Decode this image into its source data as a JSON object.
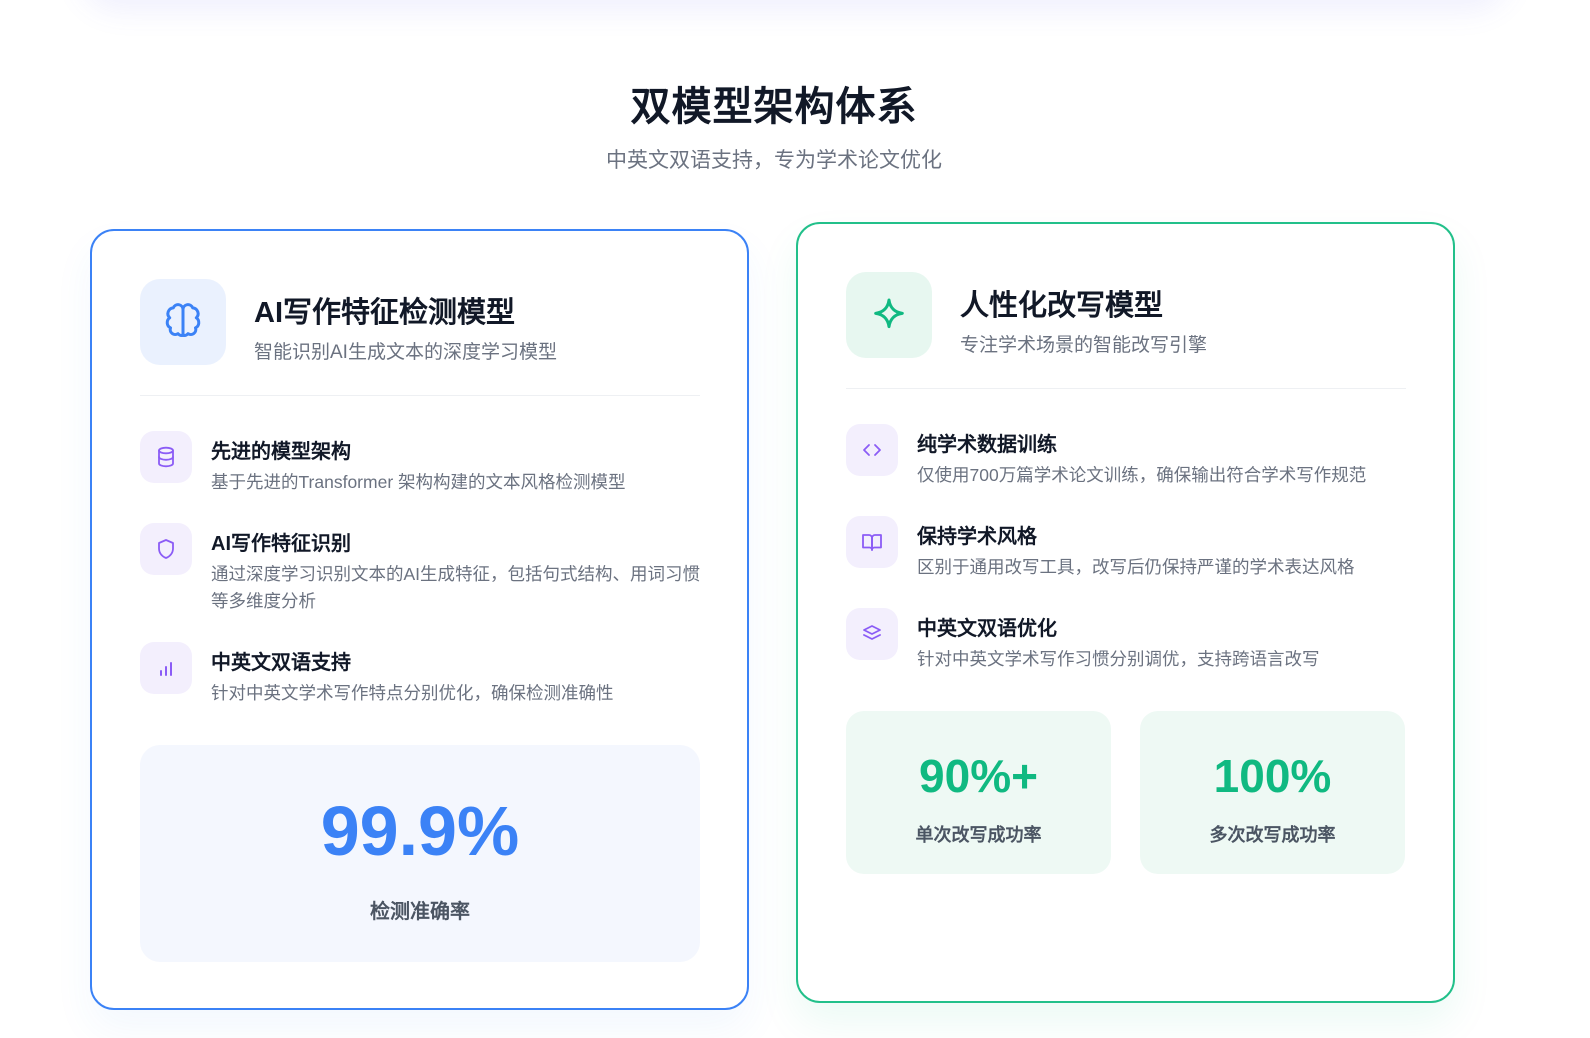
{
  "section": {
    "title": "双模型架构体系",
    "subtitle": "中英文双语支持，专为学术论文优化"
  },
  "colors": {
    "blue_accent": "#3b82f6",
    "green_accent": "#10b981",
    "purple_icon": "#8b5cf6"
  },
  "detection_model": {
    "icon": "brain-icon",
    "title": "AI写作特征检测模型",
    "description": "智能识别AI生成文本的深度学习模型",
    "features": [
      {
        "icon": "database-icon",
        "title": "先进的模型架构",
        "description": "基于先进的Transformer 架构构建的文本风格检测模型"
      },
      {
        "icon": "shield-icon",
        "title": "AI写作特征识别",
        "description": "通过深度学习识别文本的AI生成特征，包括句式结构、用词习惯等多维度分析"
      },
      {
        "icon": "bar-chart-icon",
        "title": "中英文双语支持",
        "description": "针对中英文学术写作特点分别优化，确保检测准确性"
      }
    ],
    "stat": {
      "value": "99.9%",
      "label": "检测准确率"
    }
  },
  "rewrite_model": {
    "icon": "sparkle-icon",
    "title": "人性化改写模型",
    "description": "专注学术场景的智能改写引擎",
    "features": [
      {
        "icon": "code-icon",
        "title": "纯学术数据训练",
        "description": "仅使用700万篇学术论文训练，确保输出符合学术写作规范"
      },
      {
        "icon": "book-open-icon",
        "title": "保持学术风格",
        "description": "区别于通用改写工具，改写后仍保持严谨的学术表达风格"
      },
      {
        "icon": "layers-icon",
        "title": "中英文双语优化",
        "description": "针对中英文学术写作习惯分别调优，支持跨语言改写"
      }
    ],
    "stats": [
      {
        "value": "90%+",
        "label": "单次改写成功率"
      },
      {
        "value": "100%",
        "label": "多次改写成功率"
      }
    ]
  }
}
